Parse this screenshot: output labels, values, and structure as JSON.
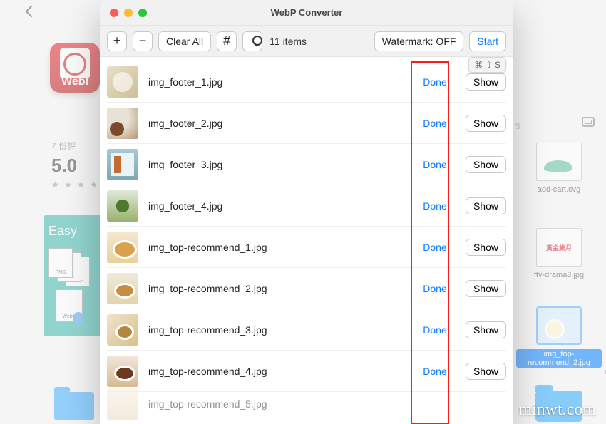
{
  "background": {
    "app_label": "WebI",
    "rating_caption": "7 份評",
    "rating_score": "5.0",
    "rating_stars": "★ ★ ★ ★",
    "easy_label": "Easy",
    "stack_labels": {
      "png": "PNG",
      "jpg": "JPG",
      "tiff": "TIFF",
      "webp": "WebP"
    }
  },
  "finder": {
    "divider": "s",
    "items": [
      {
        "label": "add-cart.svg"
      },
      {
        "label": "ftv-drama8.jpg",
        "badge": "黃金歲月"
      },
      {
        "label": "img_top-recommend_2.jpg",
        "selected": true
      }
    ],
    "more_labels": [
      "ca",
      "f",
      "rec"
    ]
  },
  "window": {
    "title": "WebP Converter",
    "toolbar": {
      "add": "+",
      "remove": "−",
      "clear": "Clear All",
      "hash": "#",
      "count": "11 items",
      "watermark": "Watermark: OFF",
      "start": "Start"
    },
    "shortcut": "⌘ ⇧ S",
    "status_text": "Done!",
    "show_text": "Show",
    "rows": [
      {
        "name": "img_footer_1.jpg",
        "thumb": "t1",
        "show": true
      },
      {
        "name": "img_footer_2.jpg",
        "thumb": "t2",
        "show": true
      },
      {
        "name": "img_footer_3.jpg",
        "thumb": "t3",
        "show": true
      },
      {
        "name": "img_footer_4.jpg",
        "thumb": "t4",
        "show": true
      },
      {
        "name": "img_top-recommend_1.jpg",
        "thumb": "t5",
        "show": true
      },
      {
        "name": "img_top-recommend_2.jpg",
        "thumb": "t6",
        "show": true
      },
      {
        "name": "img_top-recommend_3.jpg",
        "thumb": "t7",
        "show": true
      },
      {
        "name": "img_top-recommend_4.jpg",
        "thumb": "t8",
        "show": true
      },
      {
        "name": "img_top-recommend_5.jpg",
        "thumb": "t9",
        "show": false,
        "partial": true
      }
    ]
  },
  "site_watermark": "minwt.com"
}
